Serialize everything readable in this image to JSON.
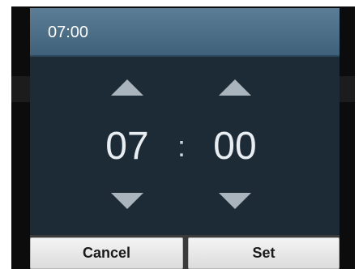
{
  "dialog": {
    "title": "07:00"
  },
  "picker": {
    "hour": "07",
    "separator": ":",
    "minute": "00",
    "increase_icon": "triangle-up-icon",
    "decrease_icon": "triangle-down-icon"
  },
  "buttons": {
    "cancel_label": "Cancel",
    "set_label": "Set"
  },
  "colors": {
    "header": "#4f7089",
    "body": "#1d2b36",
    "arrow": "#a9b4bc",
    "text": "#e9eef2",
    "button": "#e8e8e8"
  }
}
